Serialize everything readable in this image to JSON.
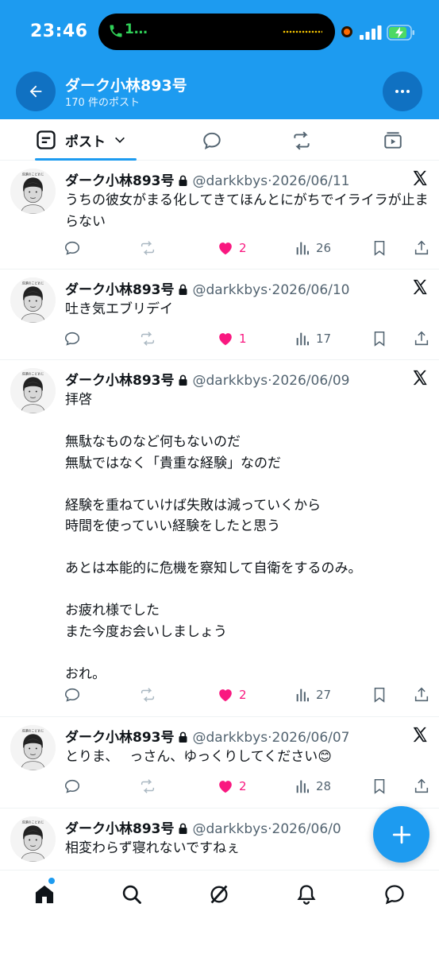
{
  "status_bar": {
    "time": "23:46",
    "call_label": "1…"
  },
  "header": {
    "title": "ダーク小林893号",
    "subtitle": "170 件のポスト"
  },
  "tabs": {
    "posts_label": "ポスト"
  },
  "tweets": [
    {
      "name": "ダーク小林893号",
      "handle": "@darkkbys",
      "date": "2026/06/11",
      "text": "うちの彼女がまる化してきてほんとにがちでイライラが止まらない",
      "likes": "2",
      "views": "26"
    },
    {
      "name": "ダーク小林893号",
      "handle": "@darkkbys",
      "date": "2026/06/10",
      "text": "吐き気エブリデイ",
      "likes": "1",
      "views": "17"
    },
    {
      "name": "ダーク小林893号",
      "handle": "@darkkbys",
      "date": "2026/06/09",
      "text": "拝啓\n\n無駄なものなど何もないのだ\n無駄ではなく「貴重な経験」なのだ\n\n経験を重ねていけば失敗は減っていくから\n時間を使っていい経験をしたと思う\n\nあとは本能的に危機を察知して自衛をするのみ。\n\nお疲れ様でした\nまた今度お会いしましょう\n\nおれ。",
      "likes": "2",
      "views": "27"
    },
    {
      "name": "ダーク小林893号",
      "handle": "@darkkbys",
      "date": "2026/06/07",
      "text": "とりま、　 っさん、ゆっくりしてください😊",
      "likes": "2",
      "views": "28"
    },
    {
      "name": "ダーク小林893号",
      "handle": "@darkkbys",
      "date": "2026/06/0",
      "text": "相変わらず寝れないですねぇ",
      "likes": "",
      "views": ""
    }
  ],
  "avatar_caption": "成瀬のこどおじ",
  "colors": {
    "brand": "#1d9bf0",
    "like": "#f91880",
    "muted": "#536471"
  }
}
